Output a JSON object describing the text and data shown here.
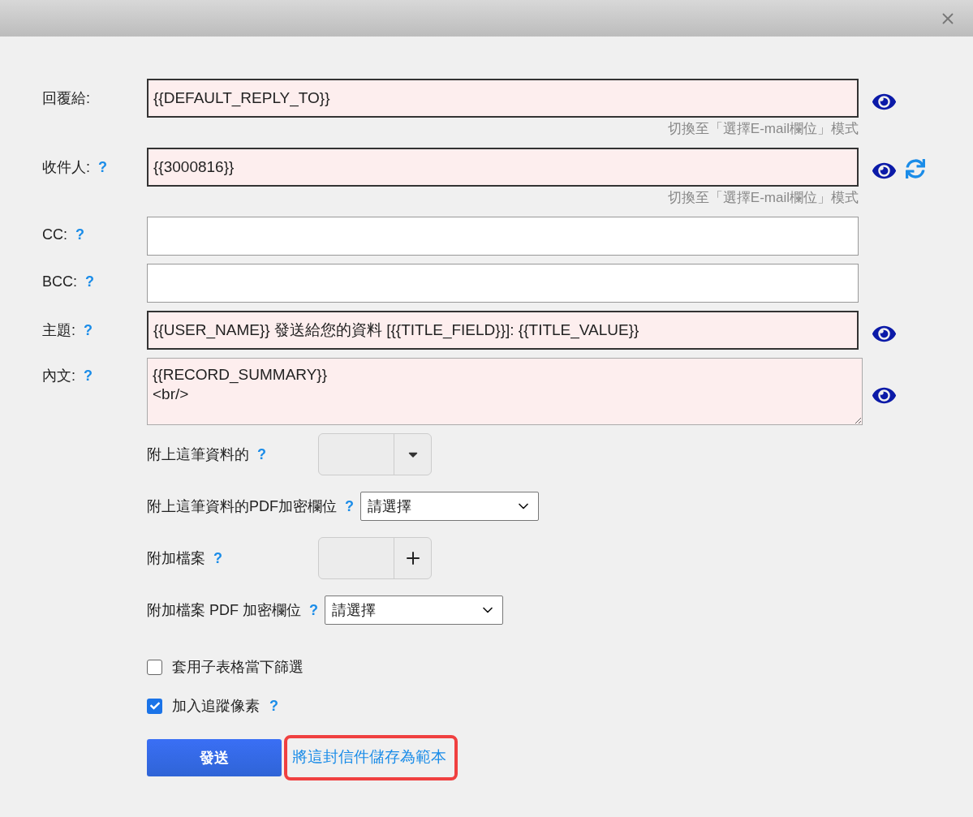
{
  "fields": [
    {
      "label": "回覆給:",
      "kind": "input",
      "value": "{{DEFAULT_REPLY_TO}}",
      "template": true,
      "hint": "切換至「選擇E-mail欄位」模式",
      "preview": true,
      "refresh": false
    },
    {
      "label": "收件人:",
      "help": "?",
      "kind": "input",
      "value": "{{3000816}}",
      "template": true,
      "hint": "切換至「選擇E-mail欄位」模式",
      "preview": true,
      "refresh": true
    },
    {
      "label": "CC:",
      "help": "?",
      "kind": "input",
      "template": false,
      "preview": false,
      "refresh": false
    },
    {
      "label": "BCC:",
      "help": "?",
      "kind": "input",
      "template": false,
      "preview": false,
      "refresh": false
    },
    {
      "label": "主題:",
      "help": "?",
      "kind": "input",
      "value": "{{USER_NAME}} 發送給您的資料 [{{TITLE_FIELD}}]: {{TITLE_VALUE}}",
      "template": true,
      "preview": true,
      "refresh": false
    },
    {
      "label": "內文:",
      "help": "?",
      "kind": "textarea",
      "value": "{{RECORD_SUMMARY}}\n<br/>",
      "template": true,
      "preview": true,
      "refresh": false
    }
  ],
  "attachments": [
    {
      "label": "附上這筆資料的",
      "help": "?",
      "kind": "dropdown"
    },
    {
      "label": "附上這筆資料的PDF加密欄位",
      "help": "?",
      "kind": "select",
      "value": "請選擇"
    },
    {
      "label": "附加檔案",
      "help": "?",
      "kind": "add"
    },
    {
      "label": "附加檔案 PDF 加密欄位",
      "help": "?",
      "kind": "select",
      "value": "請選擇"
    }
  ],
  "options": [
    {
      "label": "套用子表格當下篩選",
      "checked": false
    },
    {
      "label": "加入追蹤像素",
      "checked": true,
      "help": "?"
    }
  ],
  "send_button": "發送",
  "template_link": {
    "label": "將這封信件儲存為範本",
    "highlighted": true
  }
}
